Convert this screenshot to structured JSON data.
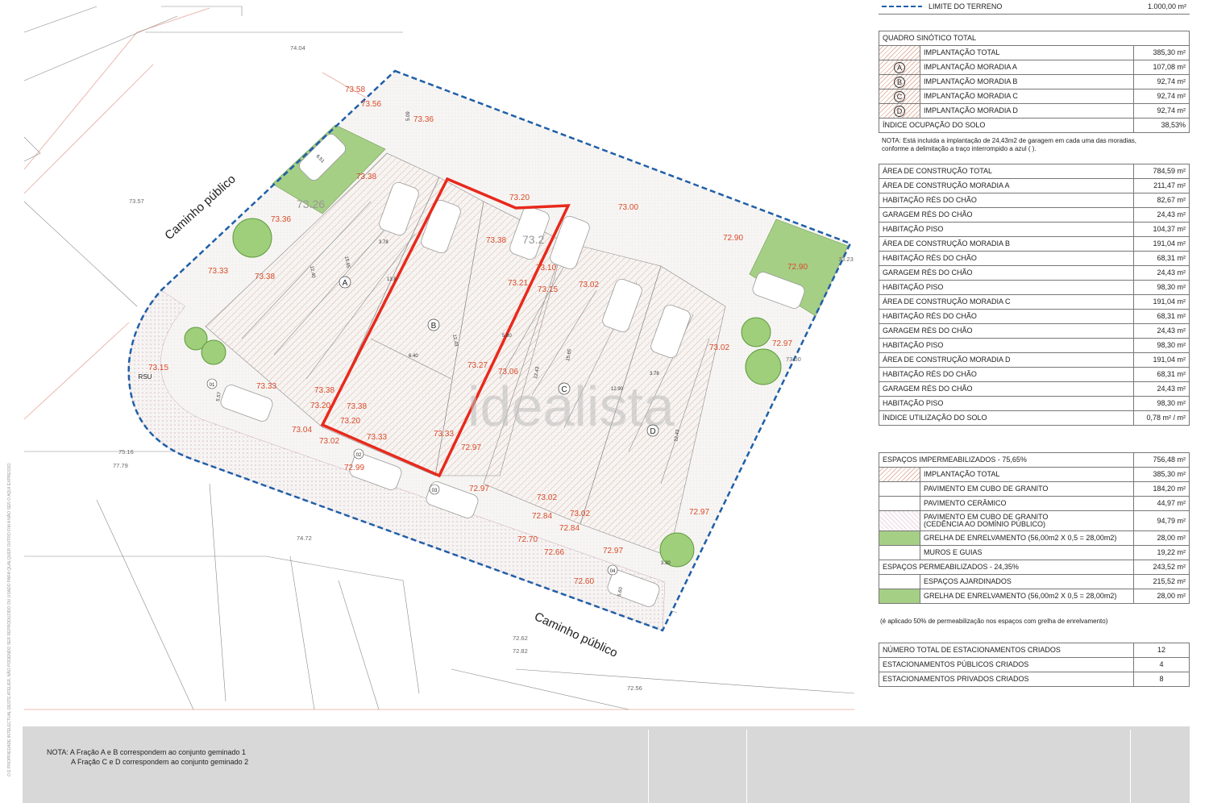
{
  "legend_top": {
    "label": "LIMITE DO TERRENO",
    "value": "1.000,00 m²"
  },
  "quadro": {
    "title": "QUADRO SINÓTICO TOTAL",
    "rows": [
      {
        "key": "",
        "label": "IMPLANTAÇÃO TOTAL",
        "value": "385,30 m²"
      },
      {
        "key": "A",
        "label": "IMPLANTAÇÃO MORADIA A",
        "value": "107,08 m²"
      },
      {
        "key": "B",
        "label": "IMPLANTAÇÃO MORADIA B",
        "value": "92,74 m²"
      },
      {
        "key": "C",
        "label": "IMPLANTAÇÃO MORADIA C",
        "value": "92,74 m²"
      },
      {
        "key": "D",
        "label": "IMPLANTAÇÃO MORADIA D",
        "value": "92,74 m²"
      }
    ],
    "indice_label": "ÍNDICE OCUPAÇÃO DO SOLO",
    "indice_value": "38,53%",
    "nota_1": "NOTA: Está incluida a implantação de  24,43m2 de garagem em cada uma das moradias,",
    "nota_2": "conforme a delimitação a traço interrompido a azul (              )."
  },
  "construcao": [
    {
      "label": "ÁREA DE CONSTRUÇÃO TOTAL",
      "value": "784,59 m²"
    },
    {
      "label": "ÁREA DE CONSTRUÇÃO MORADIA A",
      "value": "211,47 m²"
    },
    {
      "label": "HABITAÇÃO RÉS DO CHÃO",
      "value": "82,67 m²"
    },
    {
      "label": "GARAGEM RÉS DO CHÃO",
      "value": "24,43 m²"
    },
    {
      "label": "HABITAÇÃO PISO",
      "value": "104,37 m²"
    },
    {
      "label": "ÁREA DE CONSTRUÇÃO MORADIA B",
      "value": "191,04 m²"
    },
    {
      "label": "HABITAÇÃO RÉS DO CHÃO",
      "value": "68,31 m²"
    },
    {
      "label": "GARAGEM RÉS DO CHÃO",
      "value": "24,43 m²"
    },
    {
      "label": "HABITAÇÃO PISO",
      "value": "98,30 m²"
    },
    {
      "label": "ÁREA DE CONSTRUÇÃO MORADIA C",
      "value": "191,04 m²"
    },
    {
      "label": "HABITAÇÃO RÉS DO CHÃO",
      "value": "68,31 m²"
    },
    {
      "label": "GARAGEM RÉS DO CHÃO",
      "value": "24,43 m²"
    },
    {
      "label": "HABITAÇÃO PISO",
      "value": "98,30 m²"
    },
    {
      "label": "ÁREA DE CONSTRUÇÃO MORADIA D",
      "value": "191,04 m²"
    },
    {
      "label": "HABITAÇÃO RÉS DO CHÃO",
      "value": "68,31 m²"
    },
    {
      "label": "GARAGEM RÉS DO CHÃO",
      "value": "24,43 m²"
    },
    {
      "label": "HABITAÇÃO PISO",
      "value": "98,30 m²"
    },
    {
      "label": "ÍNDICE UTILIZAÇÃO DO SOLO",
      "value": "0,78 m² / m²"
    }
  ],
  "espacos": {
    "imperm_label": "ESPAÇOS IMPERMEABILIZADOS - 75,65%",
    "imperm_value": "756,48 m²",
    "imperm_rows": [
      {
        "swatch": "hatch",
        "label": "IMPLANTAÇÃO TOTAL",
        "value": "385,30 m²"
      },
      {
        "swatch": "cubo",
        "label": "PAVIMENTO EM CUBO DE GRANITO",
        "value": "184,20 m²"
      },
      {
        "swatch": "cubo",
        "label": "PAVIMENTO CERÂMICO",
        "value": "44,97 m²"
      },
      {
        "swatch": "dots",
        "label": "PAVIMENTO EM CUBO DE GRANITO",
        "label2": "(CEDÊNCIA AO DOMÍNIO PÚBLICO)",
        "value": "94,79 m²"
      },
      {
        "swatch": "grass",
        "label": "GRELHA DE ENRELVAMENTO (56,00m2 X 0,5 = 28,00m2)",
        "value": "28,00 m²"
      },
      {
        "swatch": "cubo",
        "label": "MUROS E GUIAS",
        "value": "19,22 m²"
      }
    ],
    "perm_label": "ESPAÇOS PERMEABILIZADOS - 24,35%",
    "perm_value": "243,52 m²",
    "perm_rows": [
      {
        "swatch": "cubo",
        "label": "ESPAÇOS AJARDINADOS",
        "value": "215,52 m²"
      },
      {
        "swatch": "grass",
        "label": "GRELHA DE ENRELVAMENTO (56,00m2 X 0,5 = 28,00m2)",
        "value": "28,00 m²"
      }
    ],
    "nota": "(é aplicado 50% de permeabilização nos espaços com grelha de enrelvamento)"
  },
  "estacionamentos": [
    {
      "label": "NÚMERO TOTAL DE ESTACIONAMENTOS CRIADOS",
      "value": "12"
    },
    {
      "label": "ESTACIONAMENTOS PÚBLICOS CRIADOS",
      "value": "4"
    },
    {
      "label": "ESTACIONAMENTOS PRIVADOS CRIADOS",
      "value": "8"
    }
  ],
  "footer": {
    "nota_1": "NOTA: A Fração A e B correspondem ao conjunto geminado 1",
    "nota_2": "A Fração C e D correspondem ao conjunto geminado 2"
  },
  "side_text": "O E PROPRIEDADE INTELECTUAL DESTE ATELIER, NÃO PODENDO SER REPRODUZIDO OU USADO PARA QUALQUER OUTRO FIM A NÃO SER O AQUI EXPRESSO.",
  "plan": {
    "watermark": "idealista",
    "street_labels": [
      "Caminho público",
      "Caminho público"
    ],
    "lot_labels": [
      "A",
      "B",
      "C",
      "D"
    ],
    "rsu": "RSU",
    "parking_numbers": [
      "01",
      "02",
      "03",
      "04"
    ],
    "dims": [
      "5.09",
      "6.51",
      "3.78",
      "15.65",
      "12.40",
      "13.8",
      "12.43",
      "6.40",
      "5.80",
      "15.65",
      "12.43",
      "12.90",
      "3.78",
      "12.43",
      "3.30",
      "5.57",
      "5.60"
    ],
    "ground_elevations": [
      "74.04",
      "73.57",
      "75.16",
      "77.79",
      "74.72",
      "72.62",
      "72.82",
      "72.56",
      "73.23",
      "73.00"
    ],
    "spot_elevations": [
      "73.58",
      "73.56",
      "73.36",
      "73.38",
      "73.36",
      "73.33",
      "73.38",
      "73.20",
      "73.21",
      "73.15",
      "73.00",
      "72.90",
      "73.38",
      "73.10",
      "73.02",
      "72.90",
      "73.33",
      "73.38",
      "73.20",
      "73.38",
      "73.20",
      "73.04",
      "73.02",
      "73.33",
      "73.33",
      "73.27",
      "73.06",
      "72.97",
      "72.99",
      "72.97",
      "73.02",
      "72.84",
      "73.02",
      "72.84",
      "72.70",
      "72.66",
      "72.97",
      "72.60",
      "72.97",
      "73.02",
      "72.97",
      "73.15",
      "73.26",
      "73.2"
    ]
  },
  "colors": {
    "boundary": "#1f5fa8",
    "highlight": "#e8291c",
    "elevation": "#d94a2a",
    "grass": "#a6cf86",
    "hatch": "#e4b9a8",
    "footer": "#d8d8d8"
  }
}
